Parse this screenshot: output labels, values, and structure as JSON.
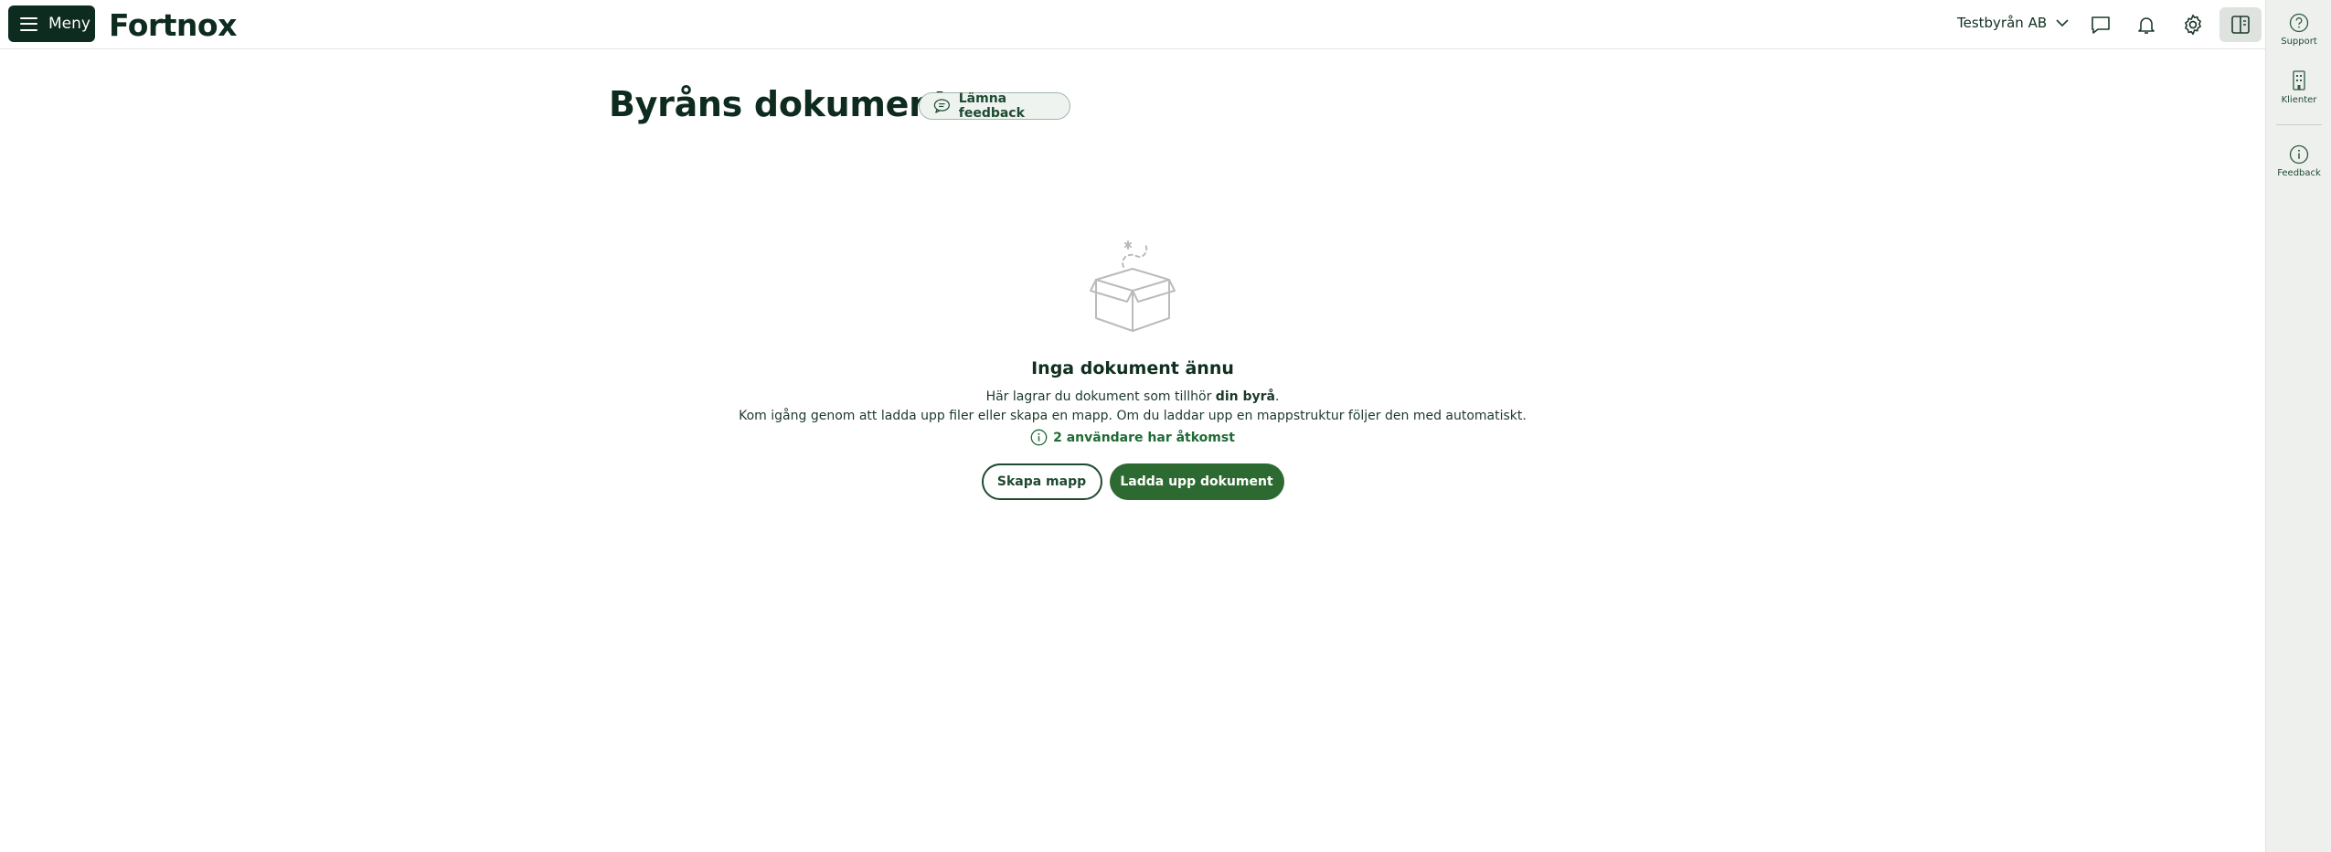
{
  "topbar": {
    "menu_label": "Meny",
    "logo_text": "Fortnox",
    "company_name": "Testbyrån AB"
  },
  "sidebar_right": {
    "items": [
      {
        "label": "Support",
        "icon": "question-circle-icon"
      },
      {
        "label": "Klienter",
        "icon": "building-icon"
      },
      {
        "label": "Feedback",
        "icon": "info-circle-icon"
      }
    ]
  },
  "main": {
    "title": "Byråns dokument",
    "feedback_button": "Lämna feedback",
    "empty_state": {
      "title": "Inga dokument ännu",
      "line1_prefix": "Här lagrar du dokument som tillhör ",
      "line1_bold": "din byrå",
      "line1_suffix": ".",
      "line2": "Kom igång genom att ladda upp filer eller skapa en mapp. Om du laddar upp en mappstruktur följer den med automatiskt.",
      "access_text": "2 användare har åtkomst",
      "create_folder_button": "Skapa mapp",
      "upload_button": "Ladda upp dokument"
    }
  },
  "colors": {
    "brand_dark": "#0d2b1e",
    "primary_green": "#2d6a31",
    "link_green": "#1f6a35",
    "rail_bg": "#eef0ee"
  }
}
